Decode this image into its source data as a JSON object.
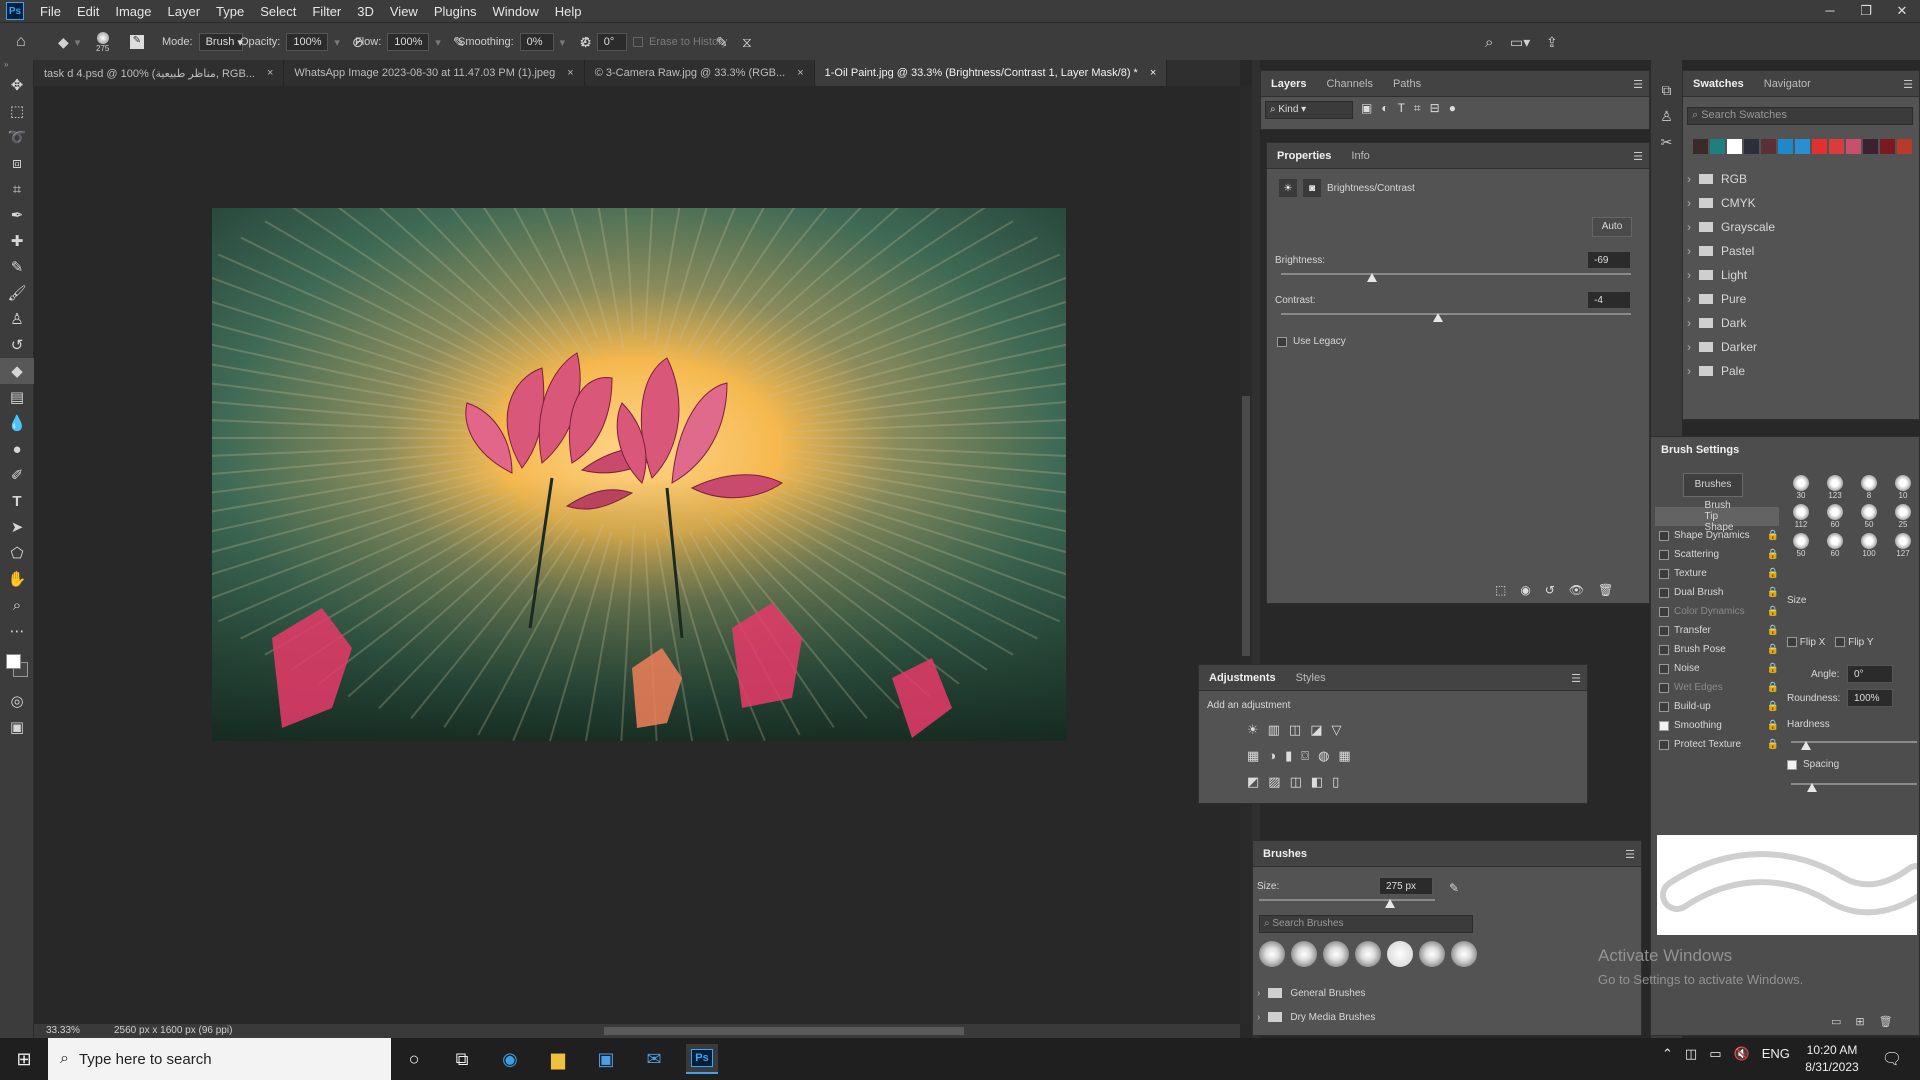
{
  "menubar": {
    "items": [
      "File",
      "Edit",
      "Image",
      "Layer",
      "Type",
      "Select",
      "Filter",
      "3D",
      "View",
      "Plugins",
      "Window",
      "Help"
    ],
    "logo": "Ps"
  },
  "options": {
    "brush_size": "275",
    "mode_label": "Mode:",
    "mode": "Brush",
    "opacity_label": "Opacity:",
    "opacity": "100%",
    "flow_label": "Flow:",
    "flow": "100%",
    "smoothing_label": "Smoothing:",
    "smoothing": "0%",
    "angle": "0°",
    "erase_history": "Erase to History"
  },
  "tabs": [
    {
      "label": "task d 4.psd @ 100% (مناظر طبيعية, RGB...",
      "close": "×"
    },
    {
      "label": "WhatsApp Image 2023-08-30 at 11.47.03 PM (1).jpeg",
      "close": "×"
    },
    {
      "label": "© 3-Camera Raw.jpg @ 33.3% (RGB...",
      "close": "×"
    },
    {
      "label": "1-Oil Paint.jpg @ 33.3% (Brightness/Contrast 1, Layer Mask/8) *",
      "close": "×"
    }
  ],
  "status": {
    "zoom": "33.33%",
    "docinfo": "2560 px x 1600 px (96 ppi)"
  },
  "layers": {
    "tabs": [
      "Layers",
      "Channels",
      "Paths"
    ],
    "kind": "Kind"
  },
  "properties": {
    "tabs": [
      "Properties",
      "Info"
    ],
    "adjustment": "Brightness/Contrast",
    "auto": "Auto",
    "brightness_label": "Brightness:",
    "brightness": "-69",
    "contrast_label": "Contrast:",
    "contrast": "-4",
    "legacy": "Use Legacy"
  },
  "adjustments": {
    "tabs": [
      "Adjustments",
      "Styles"
    ],
    "hint": "Add an adjustment"
  },
  "brushes": {
    "title": "Brushes",
    "size_label": "Size:",
    "size": "275 px",
    "search_placeholder": "Search Brushes",
    "groups": [
      "General Brushes",
      "Dry Media Brushes"
    ]
  },
  "swatches": {
    "tabs": [
      "Swatches",
      "Navigator"
    ],
    "search_placeholder": "Search Swatches",
    "colors": [
      "#3a2a2a",
      "#1e7f7f",
      "#ffffff",
      "#2b2f3a",
      "#5a2f35",
      "#1f88c8",
      "#2a8fd0",
      "#e03030",
      "#d83c3c",
      "#c8506a",
      "#3a2230",
      "#7a1a20",
      "#b83a2a"
    ],
    "groups": [
      "RGB",
      "CMYK",
      "Grayscale",
      "Pastel",
      "Light",
      "Pure",
      "Dark",
      "Darker",
      "Pale"
    ]
  },
  "brush_settings": {
    "title": "Brush Settings",
    "brushes_btn": "Brushes",
    "items": [
      {
        "label": "Brush Tip Shape",
        "check": null,
        "active": true
      },
      {
        "label": "Shape Dynamics",
        "check": false
      },
      {
        "label": "Scattering",
        "check": false
      },
      {
        "label": "Texture",
        "check": false
      },
      {
        "label": "Dual Brush",
        "check": false
      },
      {
        "label": "Color Dynamics",
        "check": false,
        "dim": true
      },
      {
        "label": "Transfer",
        "check": false
      },
      {
        "label": "Brush Pose",
        "check": false
      },
      {
        "label": "Noise",
        "check": false
      },
      {
        "label": "Wet Edges",
        "check": false,
        "dim": true
      },
      {
        "label": "Build-up",
        "check": false
      },
      {
        "label": "Smoothing",
        "check": true
      },
      {
        "label": "Protect Texture",
        "check": false
      }
    ],
    "tip_sizes": [
      "30",
      "123",
      "8",
      "10",
      "112",
      "60",
      "50",
      "25",
      "50",
      "60",
      "100",
      "127"
    ],
    "size_label": "Size",
    "flipx": "Flip X",
    "flipy": "Flip Y",
    "angle_label": "Angle:",
    "angle": "0°",
    "roundness_label": "Roundness:",
    "roundness": "100%",
    "hardness_label": "Hardness",
    "spacing_label": "Spacing"
  },
  "watermark": {
    "line1": "Activate Windows",
    "line2": "Go to Settings to activate Windows."
  },
  "taskbar": {
    "search": "Type here to search",
    "time": "10:20 AM",
    "date": "8/31/2023",
    "lang": "ENG"
  }
}
